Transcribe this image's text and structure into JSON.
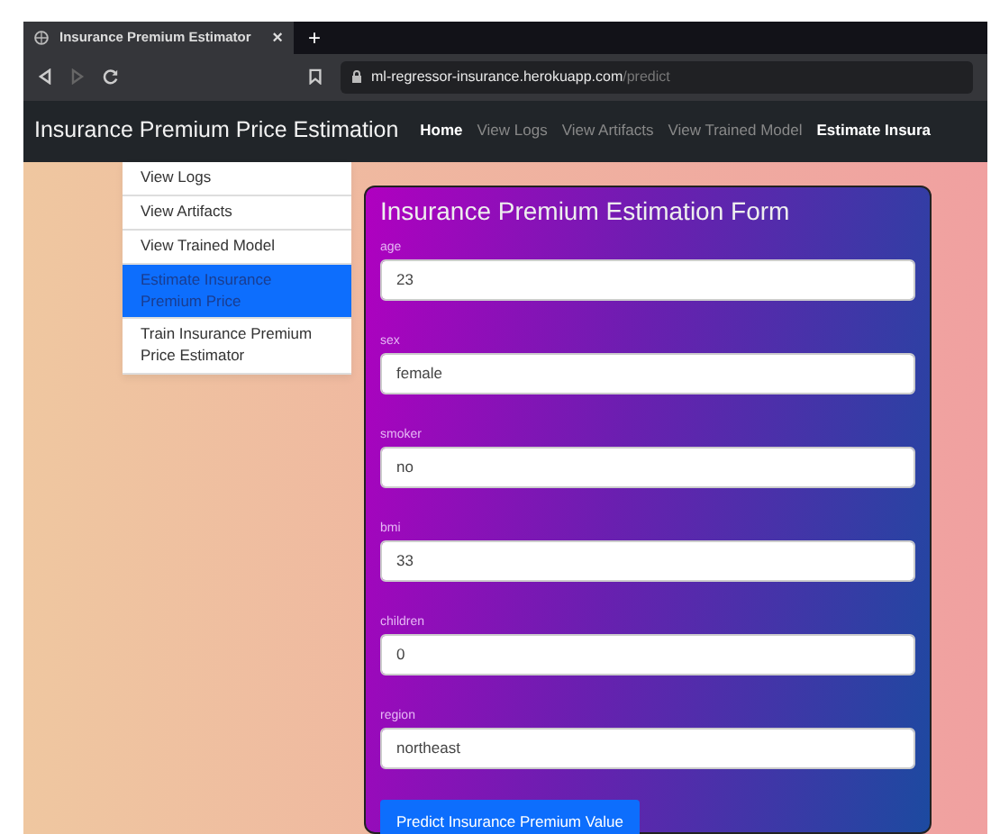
{
  "browser": {
    "tab_title": "Insurance Premium Estimator",
    "tab_close": "×",
    "new_tab": "+",
    "url_host": "ml-regressor-insurance.herokuapp.com",
    "url_path": "/predict"
  },
  "navbar": {
    "brand": "Insurance Premium Price Estimation",
    "links": [
      {
        "label": "Home",
        "selected": true
      },
      {
        "label": "View Logs",
        "selected": false
      },
      {
        "label": "View Artifacts",
        "selected": false
      },
      {
        "label": "View Trained Model",
        "selected": false
      },
      {
        "label": "Estimate Insura",
        "selected": true
      }
    ]
  },
  "dropdown": [
    {
      "label": "View Logs",
      "selected": false
    },
    {
      "label": "View Artifacts",
      "selected": false
    },
    {
      "label": "View Trained Model",
      "selected": false
    },
    {
      "label": "Estimate Insurance Premium Price",
      "selected": true
    },
    {
      "label": "Train Insurance Premium Price Estimator",
      "selected": false
    }
  ],
  "form": {
    "title": "Insurance Premium Estimation Form",
    "fields": [
      {
        "label": "age",
        "value": "23"
      },
      {
        "label": "sex",
        "value": "female"
      },
      {
        "label": "smoker",
        "value": "no"
      },
      {
        "label": "bmi",
        "value": "33"
      },
      {
        "label": "children",
        "value": "0"
      },
      {
        "label": "region",
        "value": "northeast"
      }
    ],
    "submit": "Predict Insurance Premium Value"
  }
}
